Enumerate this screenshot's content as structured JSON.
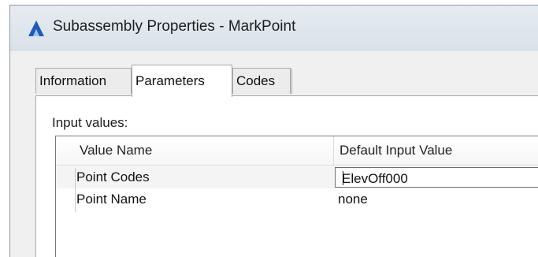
{
  "window": {
    "title": "Subassembly Properties - MarkPoint",
    "app_icon": "autocad-civil3d-icon"
  },
  "tabs": [
    {
      "label": "Information",
      "active": false
    },
    {
      "label": "Parameters",
      "active": true
    },
    {
      "label": "Codes",
      "active": false
    }
  ],
  "parameters": {
    "group_label": "Input values:",
    "columns": [
      "Value Name",
      "Default Input Value"
    ],
    "rows": [
      {
        "name": "Point Codes",
        "value": "ElevOff000",
        "editing": true
      },
      {
        "name": "Point Name",
        "value": "none",
        "editing": false
      }
    ]
  },
  "colors": {
    "icon_blue": "#1e5bb8",
    "window_bg": "#f0f0f0"
  }
}
